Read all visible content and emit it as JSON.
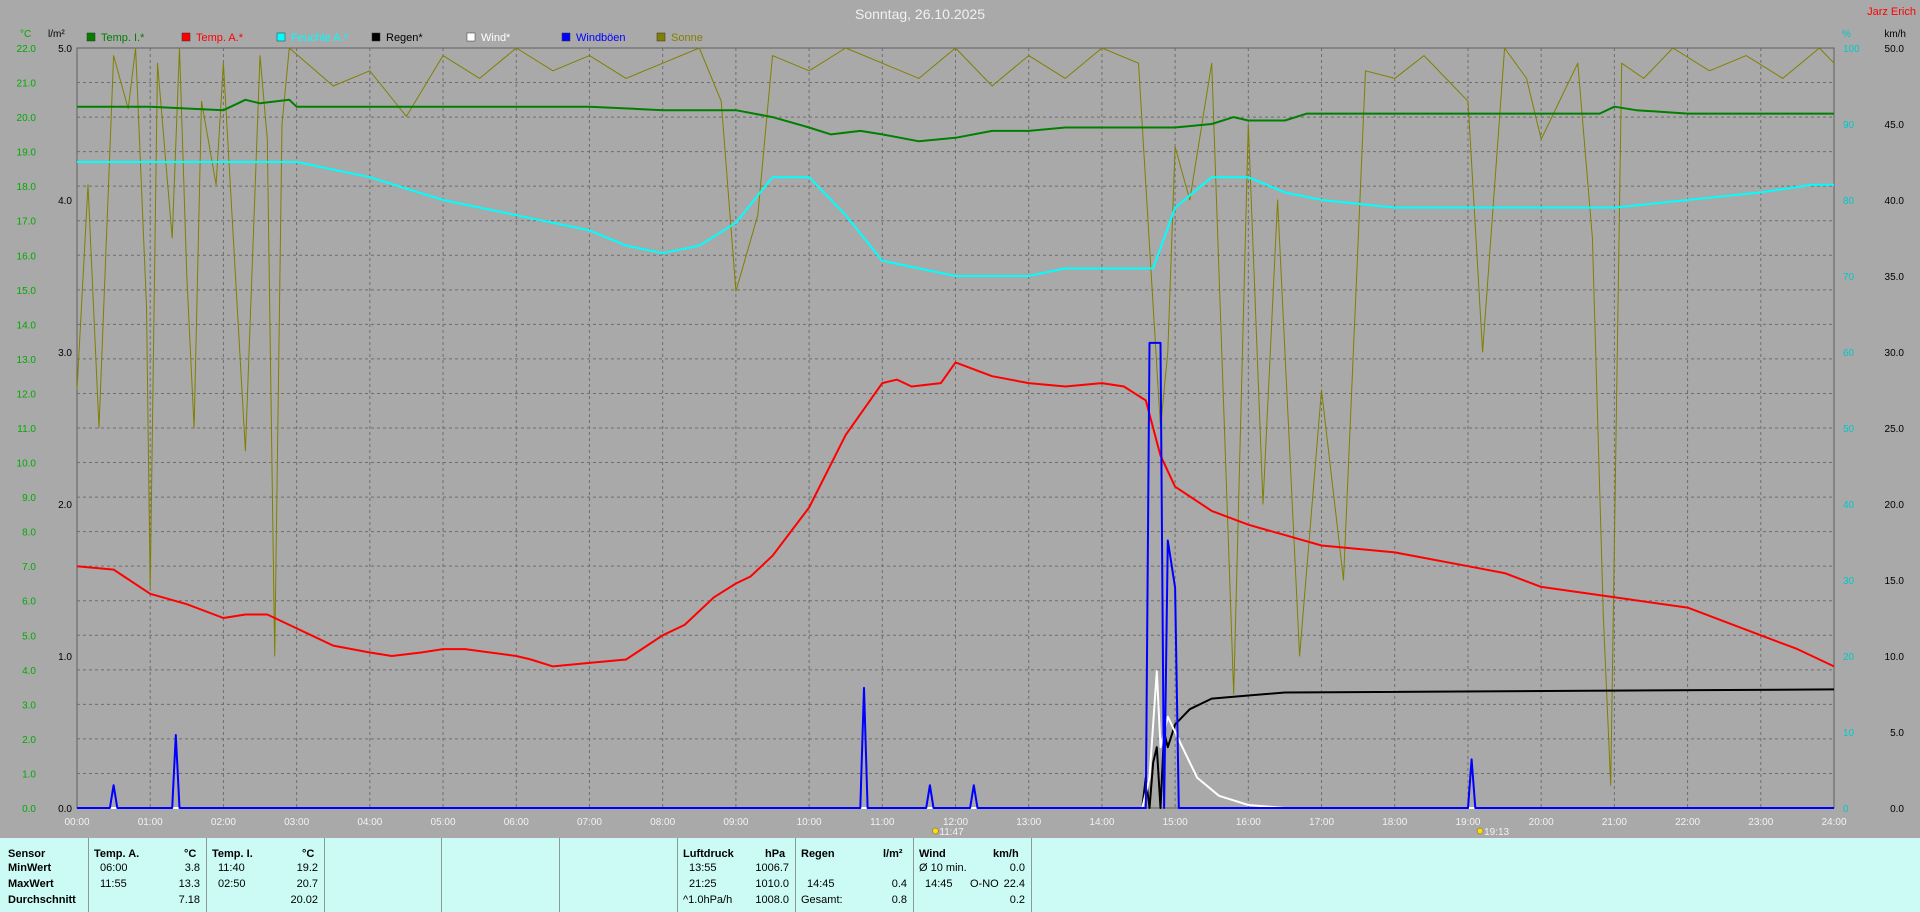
{
  "title": "Sonntag, 26.10.2025",
  "author": "Jarz Erich",
  "chart_data": {
    "type": "line",
    "x_ticks": [
      "00:00",
      "01:00",
      "02:00",
      "03:00",
      "04:00",
      "05:00",
      "06:00",
      "07:00",
      "08:00",
      "09:00",
      "10:00",
      "11:00",
      "12:00",
      "13:00",
      "14:00",
      "15:00",
      "16:00",
      "17:00",
      "18:00",
      "19:00",
      "20:00",
      "21:00",
      "22:00",
      "23:00",
      "24:00"
    ],
    "xlim": [
      0,
      24
    ],
    "axes": {
      "temp": {
        "unit": "°C",
        "ylim": [
          0,
          22
        ],
        "ticks": [
          "0.0",
          "1.0",
          "2.0",
          "3.0",
          "4.0",
          "5.0",
          "6.0",
          "7.0",
          "8.0",
          "9.0",
          "10.0",
          "11.0",
          "12.0",
          "13.0",
          "14.0",
          "15.0",
          "16.0",
          "17.0",
          "18.0",
          "19.0",
          "20.0",
          "21.0",
          "22.0"
        ]
      },
      "rain": {
        "unit": "l/m²",
        "ylim": [
          0,
          5
        ],
        "ticks": [
          "0.0",
          "1.0",
          "2.0",
          "3.0",
          "4.0",
          "5.0"
        ]
      },
      "humidity": {
        "unit": "%",
        "ylim": [
          0,
          100
        ],
        "ticks": [
          "0",
          "10",
          "20",
          "30",
          "40",
          "50",
          "60",
          "70",
          "80",
          "90",
          "100"
        ]
      },
      "wind": {
        "unit": "km/h",
        "ylim": [
          0,
          50
        ],
        "ticks": [
          "0.0",
          "5.0",
          "10.0",
          "15.0",
          "20.0",
          "25.0",
          "30.0",
          "35.0",
          "40.0",
          "45.0",
          "50.0"
        ]
      }
    },
    "legend": [
      {
        "label": "Temp. I.*",
        "color": "#007f00"
      },
      {
        "label": "Temp. A.*",
        "color": "#ff0000"
      },
      {
        "label": "Feuchte A.*",
        "color": "#00ffff"
      },
      {
        "label": "Regen*",
        "color": "#000000"
      },
      {
        "label": "Wind*",
        "color": "#ffffff"
      },
      {
        "label": "Windböen",
        "color": "#0000ff"
      },
      {
        "label": "Sonne",
        "color": "#808000"
      }
    ],
    "series": [
      {
        "name": "Temp. I.*",
        "axis": "temp",
        "color": "#007f00",
        "x": [
          0,
          1,
          2,
          2.3,
          2.5,
          2.9,
          3,
          4,
          5,
          6,
          7,
          8,
          8.5,
          9,
          9.5,
          10,
          10.3,
          10.7,
          11,
          11.5,
          12,
          12.5,
          13,
          13.5,
          14,
          14.5,
          15,
          15.5,
          15.8,
          16,
          16.5,
          16.8,
          17,
          18,
          19,
          20,
          20.5,
          20.8,
          21,
          21.3,
          22,
          23,
          24
        ],
        "y": [
          20.3,
          20.3,
          20.2,
          20.5,
          20.4,
          20.5,
          20.3,
          20.3,
          20.3,
          20.3,
          20.3,
          20.2,
          20.2,
          20.2,
          20,
          19.7,
          19.5,
          19.6,
          19.5,
          19.3,
          19.4,
          19.6,
          19.6,
          19.7,
          19.7,
          19.7,
          19.7,
          19.8,
          20,
          19.9,
          19.9,
          20.1,
          20.1,
          20.1,
          20.1,
          20.1,
          20.1,
          20.1,
          20.3,
          20.2,
          20.1,
          20.1,
          20.1
        ]
      },
      {
        "name": "Temp. A.*",
        "axis": "temp",
        "color": "#ff0000",
        "x": [
          0,
          0.5,
          1,
          1.5,
          2,
          2.3,
          2.6,
          2.9,
          3.5,
          4,
          4.3,
          4.7,
          5,
          5.3,
          6,
          6.2,
          6.5,
          7,
          7.5,
          8,
          8.3,
          8.7,
          9,
          9.2,
          9.5,
          10,
          10.5,
          11,
          11.2,
          11.4,
          11.8,
          12,
          12.5,
          13,
          13.5,
          14,
          14.3,
          14.6,
          14.8,
          15,
          15.5,
          16,
          16.5,
          17,
          18,
          19,
          19.5,
          20,
          21,
          22,
          23,
          23.5,
          24
        ],
        "y": [
          7.0,
          6.9,
          6.2,
          5.9,
          5.5,
          5.6,
          5.6,
          5.3,
          4.7,
          4.5,
          4.4,
          4.5,
          4.6,
          4.6,
          4.4,
          4.3,
          4.1,
          4.2,
          4.3,
          5.0,
          5.3,
          6.1,
          6.5,
          6.7,
          7.3,
          8.7,
          10.8,
          12.3,
          12.4,
          12.2,
          12.3,
          12.9,
          12.5,
          12.3,
          12.2,
          12.3,
          12.2,
          11.8,
          10.2,
          9.3,
          8.6,
          8.2,
          7.9,
          7.6,
          7.4,
          7.0,
          6.8,
          6.4,
          6.1,
          5.8,
          5.0,
          4.6,
          4.1
        ]
      },
      {
        "name": "Feuchte A.*",
        "axis": "humidity",
        "color": "#00ffff",
        "x": [
          0,
          0.5,
          1,
          2,
          3,
          4,
          5,
          6,
          7,
          7.5,
          8,
          8.5,
          9,
          9.5,
          10,
          10.5,
          11,
          11.5,
          12,
          12.5,
          13,
          13.5,
          14,
          14.5,
          14.7,
          15,
          15.5,
          16,
          16.5,
          17,
          18,
          19,
          20,
          20.5,
          21,
          22,
          23,
          23.7,
          24
        ],
        "y": [
          85,
          85,
          85,
          85,
          85,
          83,
          80,
          78,
          76,
          74,
          73,
          74,
          77,
          83,
          83,
          78,
          72,
          71,
          70,
          70,
          70,
          71,
          71,
          71,
          71,
          79,
          83,
          83,
          81,
          80,
          79,
          79,
          79,
          79,
          79,
          80,
          81,
          82,
          82
        ]
      },
      {
        "name": "Regen*",
        "axis": "rain",
        "color": "#000000",
        "x": [
          0,
          14.55,
          14.6,
          14.65,
          14.7,
          14.75,
          14.8,
          14.85,
          14.9,
          15,
          15.2,
          15.5,
          16,
          16.5,
          24
        ],
        "y": [
          0,
          0,
          0.2,
          0,
          0.3,
          0.4,
          0,
          0.5,
          0.4,
          0.55,
          0.65,
          0.72,
          0.74,
          0.76,
          0.78
        ]
      },
      {
        "name": "Wind*",
        "axis": "wind",
        "color": "#ffffff",
        "x": [
          0,
          14.55,
          14.65,
          14.75,
          14.8,
          14.9,
          15,
          15.1,
          15.3,
          15.6,
          16,
          16.5,
          24
        ],
        "y": [
          0,
          0,
          2,
          9,
          4,
          6,
          5,
          4,
          2,
          0.8,
          0.2,
          0,
          0
        ]
      },
      {
        "name": "Windböen",
        "axis": "wind",
        "color": "#0000ff",
        "x": [
          0,
          0.45,
          0.5,
          0.55,
          1.3,
          1.35,
          1.4,
          10.7,
          10.75,
          10.8,
          11.6,
          11.65,
          11.7,
          12.2,
          12.25,
          12.3,
          14.6,
          14.65,
          14.8,
          14.85,
          14.9,
          15,
          15.05,
          15.1,
          19.0,
          19.05,
          19.1,
          24
        ],
        "y": [
          0,
          0,
          1.5,
          0,
          0,
          4.8,
          0,
          0,
          7.9,
          0,
          0,
          1.5,
          0,
          0,
          1.5,
          0,
          0,
          30.6,
          30.6,
          0,
          17.6,
          14.5,
          0,
          0,
          0,
          3.2,
          0,
          0
        ]
      },
      {
        "name": "Sonne",
        "axis": "humidity",
        "color": "#808000",
        "x": [
          0,
          0.15,
          0.3,
          0.5,
          0.7,
          0.8,
          0.95,
          1,
          1.1,
          1.3,
          1.4,
          1.5,
          1.6,
          1.7,
          1.9,
          2,
          2.3,
          2.5,
          2.6,
          2.7,
          2.8,
          2.9,
          3.5,
          4,
          4.5,
          5,
          5.5,
          6,
          6.5,
          7,
          7.5,
          8,
          8.5,
          8.8,
          9,
          9.3,
          9.5,
          10,
          10.5,
          11,
          11.5,
          12,
          12.5,
          13,
          13.5,
          14,
          14.5,
          14.8,
          14.9,
          15,
          15.2,
          15.5,
          15.8,
          16,
          16.2,
          16.4,
          16.7,
          17,
          17.3,
          17.6,
          18,
          18.4,
          18.8,
          19,
          19.2,
          19.5,
          19.8,
          20,
          20.3,
          20.5,
          20.7,
          20.85,
          20.95,
          21.1,
          21.4,
          21.8,
          22.3,
          22.8,
          23.3,
          23.8,
          24
        ],
        "y": [
          55,
          82,
          50,
          99,
          92,
          100,
          66,
          29,
          98,
          75,
          100,
          70,
          50,
          93,
          82,
          98,
          47,
          99,
          88,
          20,
          90,
          100,
          95,
          97,
          91,
          99,
          96,
          100,
          97,
          99,
          96,
          98,
          100,
          93,
          68,
          78,
          99,
          97,
          100,
          98,
          96,
          100,
          95,
          99,
          96,
          100,
          98,
          50,
          60,
          87,
          80,
          98,
          15,
          90,
          40,
          80,
          20,
          55,
          30,
          97,
          96,
          99,
          95,
          93,
          60,
          100,
          96,
          88,
          94,
          98,
          75,
          25,
          3,
          98,
          96,
          100,
          97,
          99,
          96,
          100,
          98
        ]
      }
    ],
    "markers": [
      {
        "label": "11:47",
        "x": 11.78
      },
      {
        "label": "19:13",
        "x": 19.22
      }
    ]
  },
  "stats": {
    "sensor_label": "Sensor",
    "min_label": "MinWert",
    "max_label": "MaxWert",
    "avg_label": "Durchschnitt",
    "temp_a": {
      "title": "Temp. A.",
      "unit": "°C",
      "min_time": "06:00",
      "min_val": "3.8",
      "max_time": "11:55",
      "max_val": "13.3",
      "avg_val": "7.18"
    },
    "temp_i": {
      "title": "Temp. I.",
      "unit": "°C",
      "min_time": "11:40",
      "min_val": "19.2",
      "max_time": "02:50",
      "max_val": "20.7",
      "avg_val": "20.02"
    },
    "pressure": {
      "title": "Luftdruck",
      "unit": "hPa",
      "min_time": "13:55",
      "min_val": "1006.7",
      "max_time": "21:25",
      "max_val": "1010.0",
      "avg_time": "^1.0hPa/h",
      "avg_val": "1008.0"
    },
    "rain": {
      "title": "Regen",
      "unit": "l/m²",
      "max_time": "14:45",
      "max_val": "0.4",
      "total_label": "Gesamt:",
      "total_val": "0.8"
    },
    "wind": {
      "title": "Wind",
      "unit": "km/h",
      "min_time": "Ø 10 min.",
      "min_val": "0.0",
      "max_time": "14:45",
      "max_dir": "O-NO",
      "max_val": "22.4",
      "avg_val": "0.2"
    }
  }
}
